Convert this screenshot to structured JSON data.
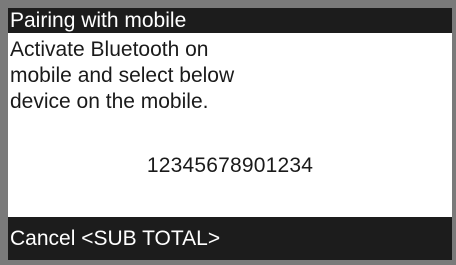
{
  "screen": {
    "title": "Pairing with mobile",
    "message_lines": [
      "Activate Bluetooth on",
      "mobile and select below",
      "device on the mobile."
    ],
    "device_id": "12345678901234",
    "soft_key": "Cancel <SUB TOTAL>"
  },
  "colors": {
    "bezel": "#7a7a7a",
    "bar_background": "#1c1c1c",
    "bar_text": "#ffffff",
    "screen_background": "#ffffff",
    "text": "#1a1a1a"
  }
}
